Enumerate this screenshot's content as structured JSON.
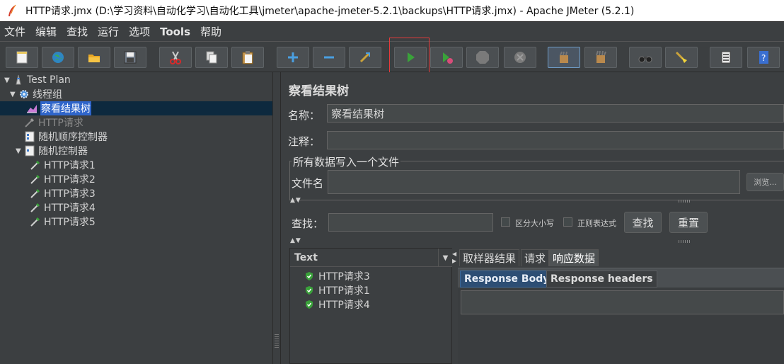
{
  "window": {
    "title": "HTTP请求.jmx (D:\\学习资料\\自动化学习\\自动化工具\\jmeter\\apache-jmeter-5.2.1\\backups\\HTTP请求.jmx) - Apache JMeter (5.2.1)"
  },
  "menu": [
    "文件",
    "编辑",
    "查找",
    "运行",
    "选项",
    "Tools",
    "帮助"
  ],
  "toolbar": {
    "buttons": [
      "new-icon",
      "templates-icon",
      "open-icon",
      "save-icon",
      "cut-icon",
      "copy-icon",
      "paste-icon",
      "expand-icon",
      "collapse-icon",
      "toggle-icon",
      "start-icon",
      "start-no-pause-icon",
      "stop-icon",
      "shutdown-icon",
      "clear-icon",
      "clear-all-icon",
      "search-icon",
      "reset-search-icon",
      "function-helper-icon",
      "help-icon"
    ]
  },
  "tree": {
    "nodes": [
      {
        "label": "Test Plan"
      },
      {
        "label": "线程组"
      },
      {
        "label": "察看结果树"
      },
      {
        "label": "HTTP请求"
      },
      {
        "label": "随机顺序控制器"
      },
      {
        "label": "随机控制器"
      },
      {
        "label": "HTTP请求1"
      },
      {
        "label": "HTTP请求2"
      },
      {
        "label": "HTTP请求3"
      },
      {
        "label": "HTTP请求4"
      },
      {
        "label": "HTTP请求5"
      }
    ]
  },
  "panel": {
    "title": "察看结果树",
    "name_label": "名称：",
    "name_value": "察看结果树",
    "comment_label": "注释：",
    "comment_value": "",
    "file_group_title": "所有数据写入一个文件",
    "filename_label": "文件名",
    "filename_value": "",
    "browse_label": "浏览...",
    "search_label": "查找：",
    "search_value": "",
    "case_sensitive_label": "区分大小写",
    "regex_label": "正则表达式",
    "search_button": "查找",
    "reset_button": "重置"
  },
  "results": {
    "renderer": "Text",
    "samples": [
      "HTTP请求3",
      "HTTP请求1",
      "HTTP请求4"
    ],
    "tabs": [
      "取样器结果",
      "请求",
      "响应数据"
    ],
    "active_tab": "响应数据",
    "subtabs": [
      "Response Body",
      "Response headers"
    ],
    "active_subtab": "Response Body"
  },
  "colors": {
    "background": "#3c3f41",
    "selection": "#2f65ca",
    "run_green": "#3aa23a",
    "highlight_red": "#e63a3a"
  }
}
